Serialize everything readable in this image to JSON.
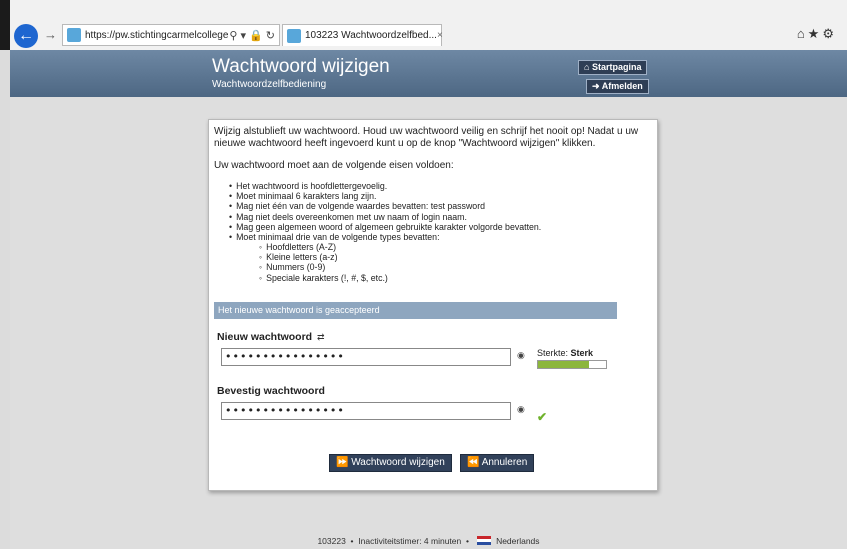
{
  "browser": {
    "url": "https://pw.stichtingcarmelcollege.nl/",
    "url_domain": "stichtingcarmelcollege.nl",
    "tab_title": "103223 Wachtwoordzelfbed...",
    "tab_close": "×"
  },
  "header": {
    "title": "Wachtwoord wijzigen",
    "subtitle": "Wachtwoordzelfbediening",
    "startpagina": "Startpagina",
    "afmelden": "Afmelden"
  },
  "content": {
    "intro": "Wijzig alstublieft uw wachtwoord. Houd uw wachtwoord veilig en schrijf het nooit op! Nadat u uw nieuwe wachtwoord heeft ingevoerd kunt u op de knop \"Wachtwoord wijzigen\" klikken.",
    "requirements_title": "Uw wachtwoord moet aan de volgende eisen voldoen:",
    "rules": [
      "Het wachtwoord is hoofdlettergevoelig.",
      "Moet minimaal 6 karakters lang zijn.",
      "Mag niet één van de volgende waardes bevatten: test password",
      "Mag niet deels overeenkomen met uw naam of login naam.",
      "Mag geen algemeen woord of algemeen gebruikte karakter volgorde bevatten.",
      "Moet minimaal drie van de volgende types bevatten:"
    ],
    "types": [
      "Hoofdletters (A-Z)",
      "Kleine letters (a-z)",
      "Nummers (0-9)",
      "Speciale karakters (!, #, $, etc.)"
    ],
    "accepted_message": "Het nieuwe wachtwoord is geaccepteerd"
  },
  "form": {
    "new_label": "Nieuw wachtwoord",
    "new_value": "••••••••••••••••",
    "confirm_label": "Bevestig wachtwoord",
    "confirm_value": "••••••••••••••••",
    "strength_label": "Sterkte:",
    "strength_value": "Sterk",
    "strength_level": 0.75,
    "submit": "Wachtwoord wijzigen",
    "cancel": "Annuleren"
  },
  "footer": {
    "id": "103223",
    "timer": "Inactiviteitstimer: 4 minuten",
    "language": "Nederlands"
  },
  "colors": {
    "header": "#5b7593",
    "accept_bar": "#8ea6bf",
    "button": "#31415a",
    "strength": "#8cb63c"
  }
}
